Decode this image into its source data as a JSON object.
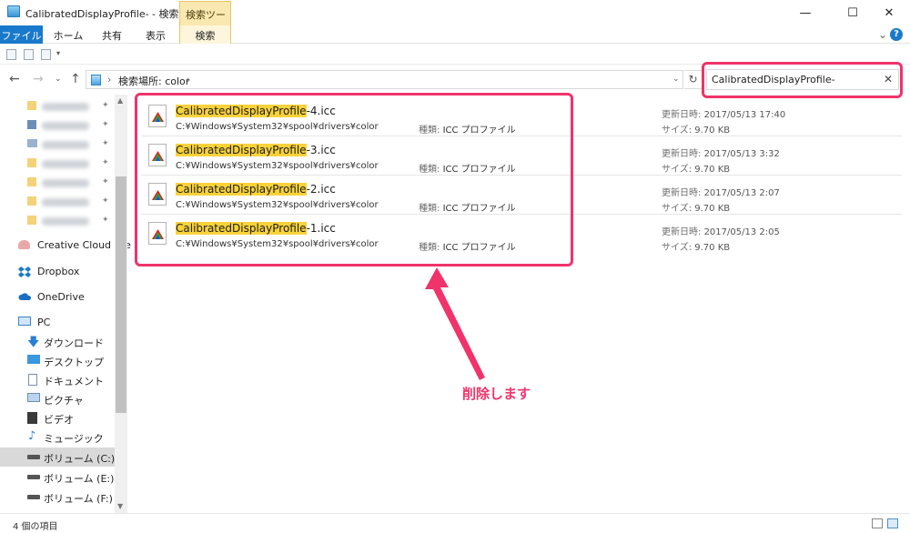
{
  "window": {
    "title": "CalibratedDisplayProfile- - 検索場...",
    "context_tab": "検索ツール"
  },
  "ribbon": {
    "tabs": [
      "ファイル",
      "ホーム",
      "共有",
      "表示",
      "検索"
    ]
  },
  "address": {
    "crumbs": [
      "検索場所: color"
    ]
  },
  "search": {
    "value": "CalibratedDisplayProfile-"
  },
  "nav": {
    "items": [
      {
        "label": "Creative Cloud File",
        "icon": "creative-cloud-icon"
      },
      {
        "label": "Dropbox",
        "icon": "dropbox-icon"
      },
      {
        "label": "OneDrive",
        "icon": "onedrive-icon"
      },
      {
        "label": "PC",
        "icon": "pc-icon"
      },
      {
        "label": "ダウンロード",
        "icon": "download-icon"
      },
      {
        "label": "デスクトップ",
        "icon": "desktop-icon"
      },
      {
        "label": "ドキュメント",
        "icon": "documents-icon"
      },
      {
        "label": "ピクチャ",
        "icon": "pictures-icon"
      },
      {
        "label": "ビデオ",
        "icon": "videos-icon"
      },
      {
        "label": "ミュージック",
        "icon": "music-icon"
      },
      {
        "label": "ボリューム (C:)",
        "icon": "drive-icon"
      },
      {
        "label": "ボリューム (E:)",
        "icon": "drive-icon"
      },
      {
        "label": "ボリューム (F:)",
        "icon": "drive-icon"
      }
    ]
  },
  "results": [
    {
      "match": "CalibratedDisplayProfile",
      "rest": "-4.icc",
      "path": "C:¥Windows¥System32¥spool¥drivers¥color",
      "type_key": "種類:",
      "type_val": "ICC プロファイル",
      "date_key": "更新日時:",
      "date_val": "2017/05/13 17:40",
      "size_key": "サイズ:",
      "size_val": "9.70 KB"
    },
    {
      "match": "CalibratedDisplayProfile",
      "rest": "-3.icc",
      "path": "C:¥Windows¥System32¥spool¥drivers¥color",
      "type_key": "種類:",
      "type_val": "ICC プロファイル",
      "date_key": "更新日時:",
      "date_val": "2017/05/13 3:32",
      "size_key": "サイズ:",
      "size_val": "9.70 KB"
    },
    {
      "match": "CalibratedDisplayProfile",
      "rest": "-2.icc",
      "path": "C:¥Windows¥System32¥spool¥drivers¥color",
      "type_key": "種類:",
      "type_val": "ICC プロファイル",
      "date_key": "更新日時:",
      "date_val": "2017/05/13 2:07",
      "size_key": "サイズ:",
      "size_val": "9.70 KB"
    },
    {
      "match": "CalibratedDisplayProfile",
      "rest": "-1.icc",
      "path": "C:¥Windows¥System32¥spool¥drivers¥color",
      "type_key": "種類:",
      "type_val": "ICC プロファイル",
      "date_key": "更新日時:",
      "date_val": "2017/05/13 2:05",
      "size_key": "サイズ:",
      "size_val": "9.70 KB"
    }
  ],
  "annotation": "削除します",
  "status": "4 個の項目",
  "colors": {
    "highlight": "#f0336b",
    "match": "#f8d23a",
    "file_tab": "#1979ca"
  }
}
